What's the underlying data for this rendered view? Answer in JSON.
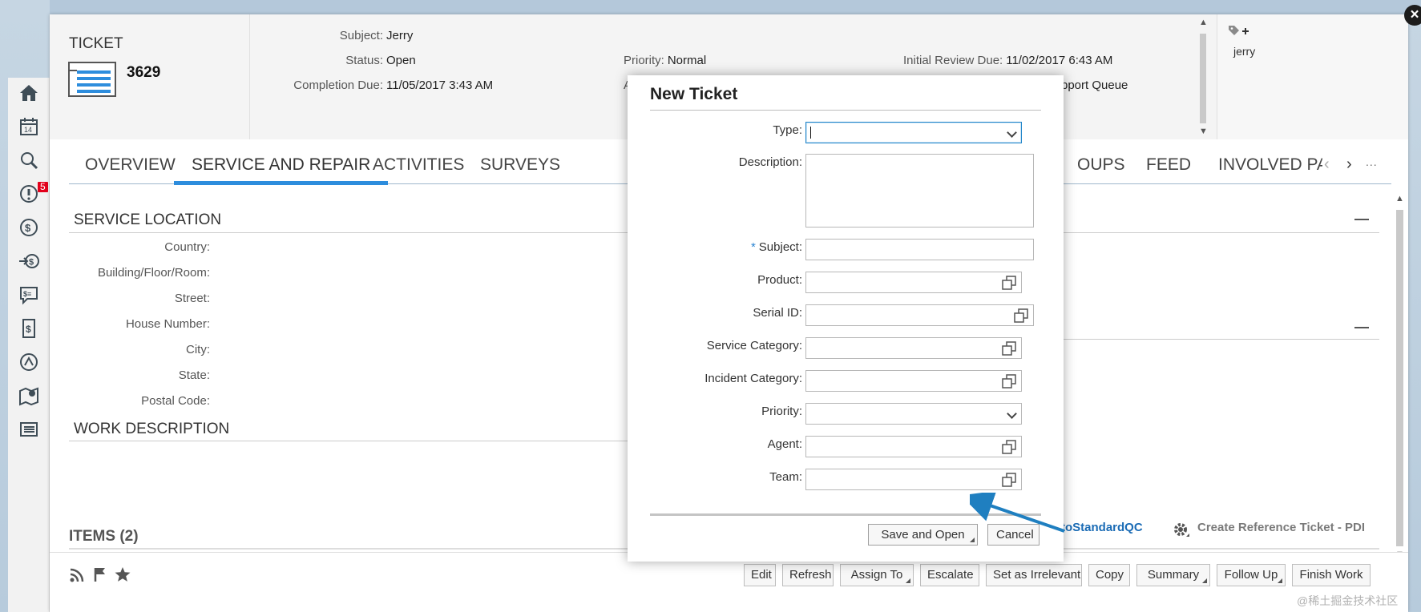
{
  "header": {
    "ticket_label": "TICKET",
    "ticket_number": "3629",
    "subject_label": "Subject:",
    "subject_value": "Jerry",
    "status_label": "Status:",
    "status_value": "Open",
    "completion_label": "Completion Due:",
    "completion_value": "11/05/2017 3:43 AM",
    "priority_label": "Priority:",
    "priority_value": "Normal",
    "review_label": "Initial Review Due:",
    "review_value": "11/02/2017 6:43 AM",
    "queue_fragment": "pport Queue",
    "a_fragment": "A",
    "tag": "jerry"
  },
  "tabs": [
    "OVERVIEW",
    "SERVICE AND REPAIR",
    "ACTIVITIES",
    "SURVEYS",
    "OUPS",
    "FEED",
    "INVOLVED PA"
  ],
  "service_location": {
    "title": "SERVICE LOCATION",
    "fields": [
      "Country:",
      "Building/Floor/Room:",
      "Street:",
      "House Number:",
      "City:",
      "State:",
      "Postal Code:"
    ]
  },
  "work_description": {
    "title": "WORK DESCRIPTION"
  },
  "items": {
    "title": "ITEMS (2)"
  },
  "links": {
    "standard": "toStandardQC",
    "reference": "Create Reference Ticket - PDI"
  },
  "toolbar": {
    "buttons": [
      "Edit",
      "Refresh",
      "Assign To",
      "Escalate",
      "Set as Irrelevant",
      "Copy",
      "Summary",
      "Follow Up",
      "Finish Work"
    ]
  },
  "rail": {
    "badge_count": "5"
  },
  "dialog": {
    "title": "New Ticket",
    "fields": {
      "type": "Type:",
      "description": "Description:",
      "subject": "Subject:",
      "product": "Product:",
      "serial": "Serial ID:",
      "service_category": "Service Category:",
      "incident_category": "Incident Category:",
      "priority": "Priority:",
      "agent": "Agent:",
      "team": "Team:"
    },
    "type_value": "",
    "save_open": "Save and Open",
    "cancel": "Cancel"
  },
  "watermark": "@稀土掘金技术社区",
  "colors": {
    "accent": "#2d8ddd",
    "badge": "#e3001b",
    "link": "#1a6bb5",
    "arrow": "#1f7fc0"
  }
}
